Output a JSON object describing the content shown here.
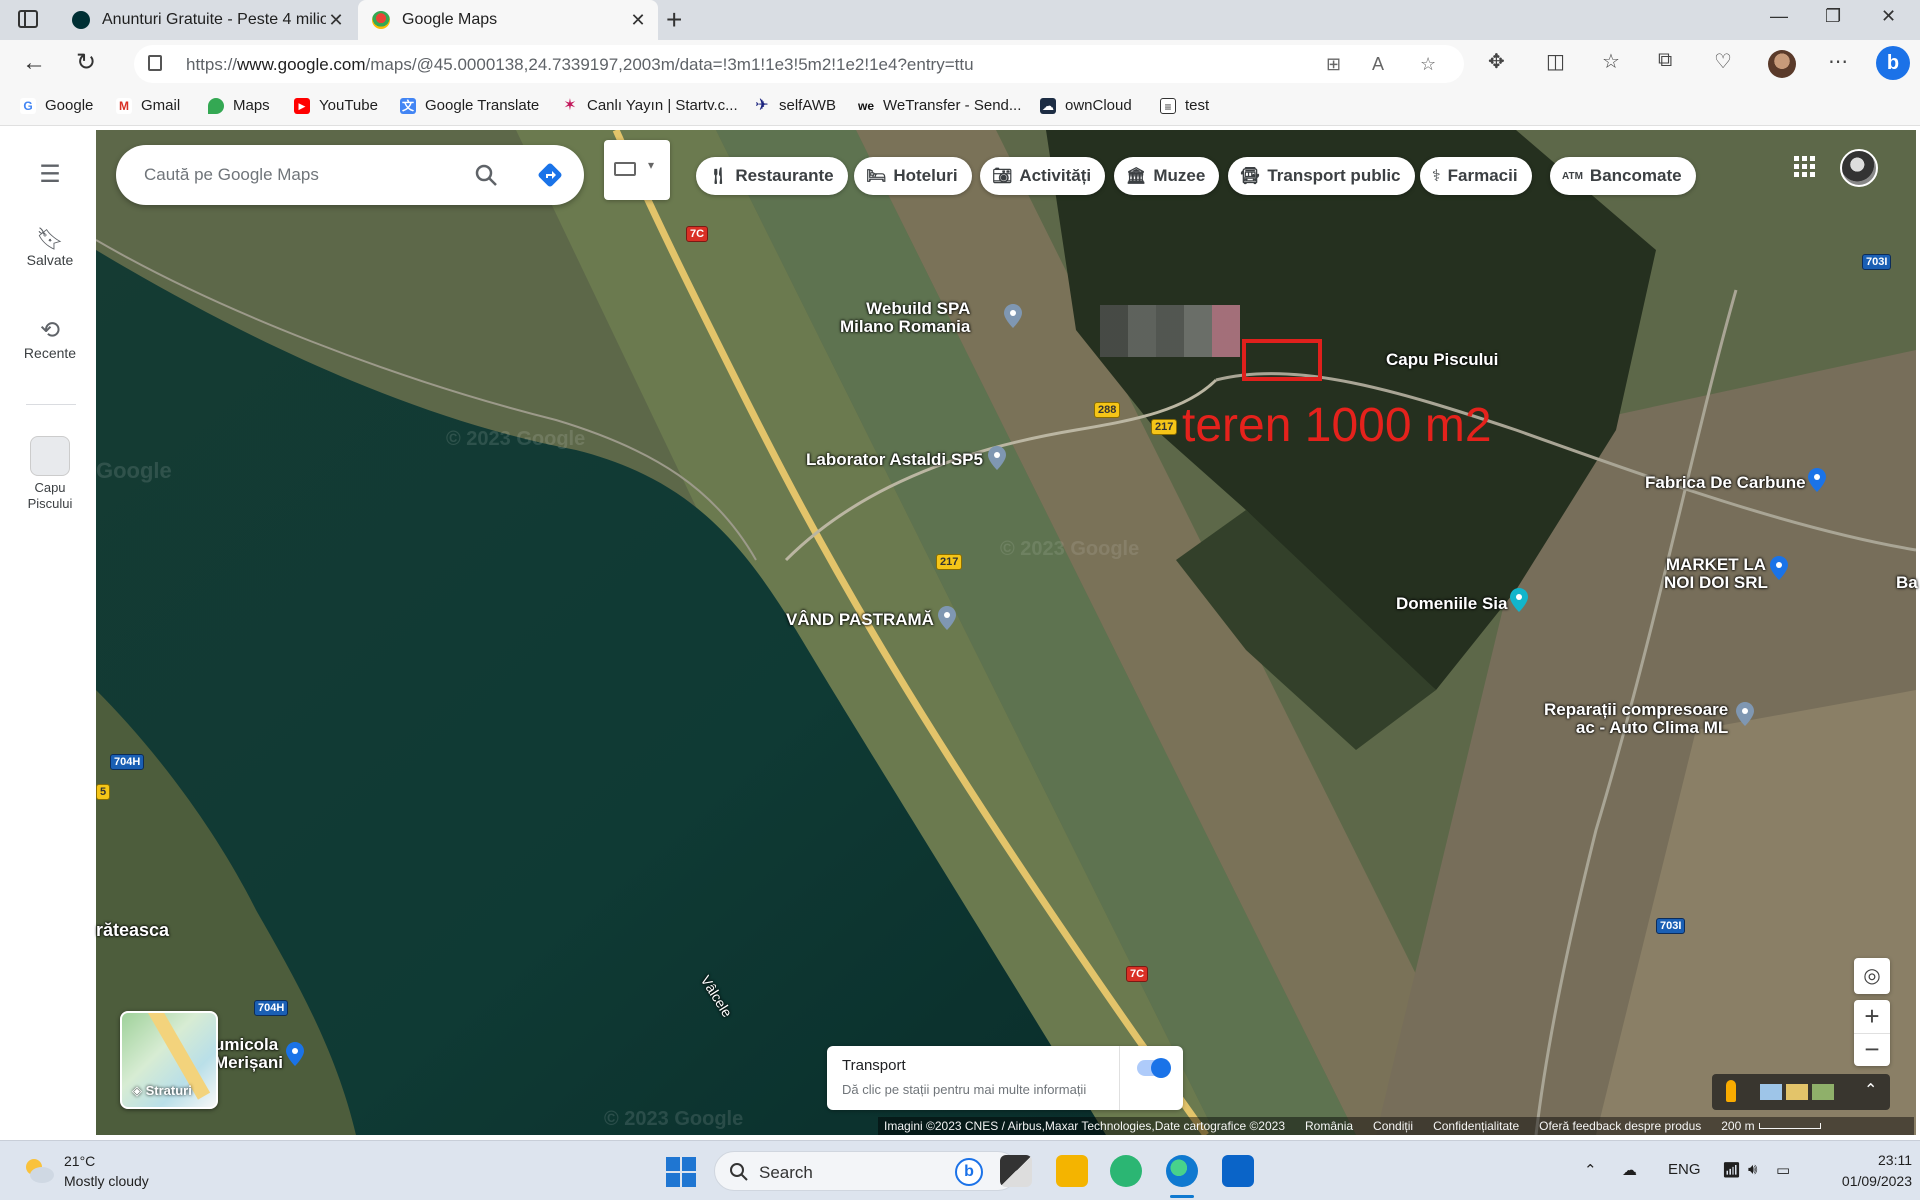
{
  "browser": {
    "tabs": [
      {
        "title": "Anunturi Gratuite - Peste 4 milio",
        "active": false
      },
      {
        "title": "Google Maps",
        "active": true
      }
    ],
    "url_prefix": "https://",
    "url_host": "www.google.com",
    "url_path": "/maps/@45.0000138,24.7339197,2003m/data=!3m1!1e3!5m2!1e2!1e4?entry=ttu",
    "bookmarks": [
      {
        "label": "Google",
        "icon": "google-icon",
        "color": "#4285f4"
      },
      {
        "label": "Gmail",
        "icon": "gmail-icon",
        "color": "#d93025"
      },
      {
        "label": "Maps",
        "icon": "maps-pin-icon",
        "color": "#34a853"
      },
      {
        "label": "YouTube",
        "icon": "youtube-icon",
        "color": "#ff0000"
      },
      {
        "label": "Google Translate",
        "icon": "translate-icon",
        "color": "#4285f4"
      },
      {
        "label": "Canlı Yayın | Startv.c...",
        "icon": "star-icon",
        "color": "#c2185b"
      },
      {
        "label": "selfAWB",
        "icon": "plane-icon",
        "color": "#1a237e"
      },
      {
        "label": "WeTransfer - Send...",
        "icon": "wetransfer-icon",
        "color": "#111111"
      },
      {
        "label": "ownCloud",
        "icon": "cloud-icon",
        "color": "#1d2d44"
      },
      {
        "label": "test",
        "icon": "calendar-icon",
        "color": "#333333"
      }
    ]
  },
  "maps": {
    "rail": {
      "saved": "Salvate",
      "recent": "Recente",
      "recent_place": "Capu Piscului"
    },
    "search_placeholder": "Caută pe Google Maps",
    "chips": [
      "Restaurante",
      "Hoteluri",
      "Activități",
      "Muzee",
      "Transport public",
      "Farmacii",
      "Bancomate"
    ],
    "places": {
      "webuild": "Webuild SPA\nMilano Romania",
      "astaldi": "Laborator Astaldi SP5",
      "pastrama": "VÂND PASTRAMĂ",
      "capu": "Capu Piscului",
      "carbune": "Fabrica De Carbune",
      "market": "MARKET LA\nNOI DOI SRL",
      "sia": "Domeniile Sia",
      "reparatii": "Reparații compresoare\nac - Auto Clima ML",
      "frateasca": "răteasca",
      "merisani": "umicola\nMerișani",
      "valcele": "Vâlcele",
      "edge_b": "Ba"
    },
    "roads": [
      "7C",
      "288",
      "217",
      "217",
      "703I",
      "704H",
      "704H",
      "703I",
      "7C",
      "5"
    ],
    "annotation": "teren 1000 m2",
    "watermarks": [
      "© 2023 Google",
      "Google",
      "© 2023 Google",
      "© 2023 Google"
    ],
    "layers_label": "Straturi",
    "transport": {
      "title": "Transport",
      "hint": "Dă clic pe stații pentru mai multe informații",
      "enabled": true
    },
    "footer": {
      "imagery": "Imagini ©2023 CNES / Airbus,Maxar Technologies,Date cartografice ©2023",
      "country": "România",
      "terms": "Condiții",
      "privacy": "Confidențialitate",
      "feedback": "Oferă feedback despre produs",
      "scale": "200 m"
    }
  },
  "taskbar": {
    "temperature": "21°C",
    "condition": "Mostly cloudy",
    "search_label": "Search",
    "language": "ENG",
    "time": "23:11",
    "date": "01/09/2023"
  }
}
